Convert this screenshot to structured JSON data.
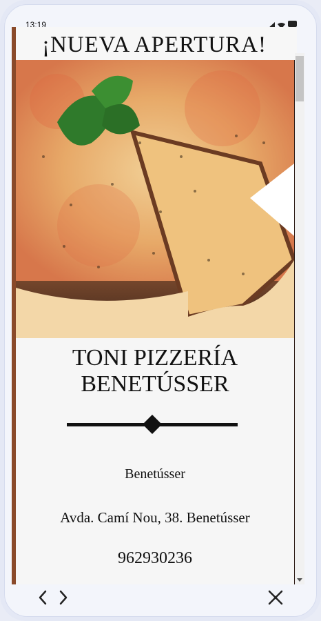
{
  "status_bar": {
    "time": "13:19"
  },
  "page": {
    "headline": "¡NUEVA APERTURA!",
    "title_line1": "TONI PIZZERÍA",
    "title_line2": "BENETÚSSER",
    "location": "Benetússer",
    "address": "Avda. Camí Nou, 38. Benetússer",
    "phone": "962930236"
  },
  "toolbar": {
    "back_icon": "chevron-left-icon",
    "forward_icon": "chevron-right-icon",
    "close_icon": "close-icon"
  },
  "colors": {
    "text": "#111111",
    "divider": "#111111",
    "background": "#f6f6f6"
  }
}
